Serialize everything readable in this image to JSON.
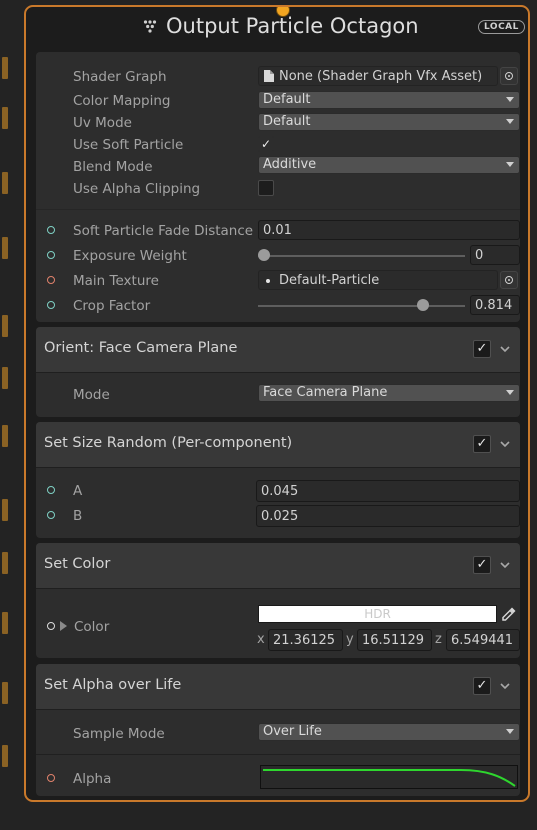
{
  "node": {
    "title": "Output Particle Octagon",
    "badge": "LOCAL",
    "icon": "vfx-particle-icon",
    "accent_color": "#c9792b"
  },
  "output": {
    "shader_graph": {
      "label": "Shader Graph",
      "value": "None (Shader Graph Vfx Asset)"
    },
    "color_mapping": {
      "label": "Color Mapping",
      "value": "Default"
    },
    "uv_mode": {
      "label": "Uv Mode",
      "value": "Default"
    },
    "use_soft_particle": {
      "label": "Use Soft Particle",
      "checked": true,
      "mark": "✓"
    },
    "blend_mode": {
      "label": "Blend Mode",
      "value": "Additive"
    },
    "use_alpha_clipping": {
      "label": "Use Alpha Clipping",
      "checked": false
    },
    "soft_particle_fade_distance": {
      "label": "Soft Particle Fade Distance",
      "value": "0.01"
    },
    "exposure_weight": {
      "label": "Exposure Weight",
      "value": "0",
      "slider_fraction": 0
    },
    "main_texture": {
      "label": "Main Texture",
      "value": "Default-Particle"
    },
    "crop_factor": {
      "label": "Crop Factor",
      "value": "0.814",
      "slider_fraction": 0.814
    }
  },
  "blocks": {
    "orient": {
      "title": "Orient: Face Camera Plane",
      "enabled": true,
      "mark": "✓",
      "mode_label": "Mode",
      "mode_value": "Face Camera Plane"
    },
    "set_size": {
      "title": "Set Size Random (Per-component)",
      "enabled": true,
      "mark": "✓",
      "a_label": "A",
      "a_value": "0.045",
      "b_label": "B",
      "b_value": "0.025"
    },
    "set_color": {
      "title": "Set Color",
      "enabled": true,
      "mark": "✓",
      "color_label": "Color",
      "swatch_color": "#ffffff",
      "hdr_label": "HDR",
      "x_label": "x",
      "x_value": "21.36125",
      "y_label": "y",
      "y_value": "16.51129",
      "z_label": "z",
      "z_value": "6.549441"
    },
    "set_alpha": {
      "title": "Set Alpha over Life",
      "enabled": true,
      "mark": "✓",
      "sample_mode_label": "Sample Mode",
      "sample_mode_value": "Over Life",
      "alpha_label": "Alpha",
      "curve_color": "#2ed62e"
    }
  }
}
